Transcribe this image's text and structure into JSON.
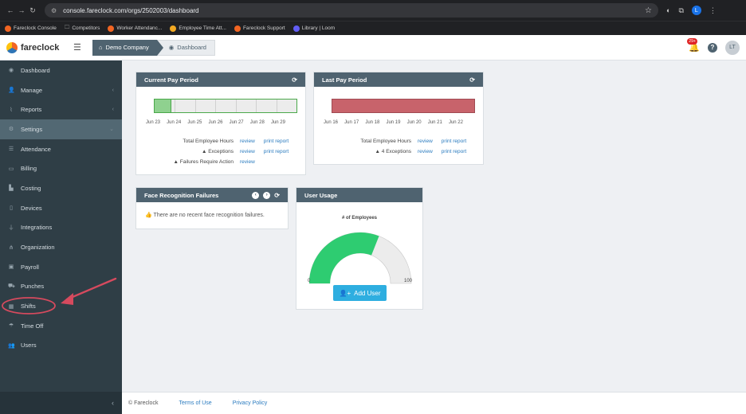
{
  "browser": {
    "url": "console.fareclock.com/orgs/2502003/dashboard",
    "profile_initial": "L",
    "bookmarks": [
      "Fareclock Console",
      "Competitors",
      "Worker Attendanc...",
      "Employee Time Att...",
      "Fareclock Support",
      "Library | Loom"
    ]
  },
  "header": {
    "logo_text": "fareclock",
    "company": "Demo Company",
    "page": "Dashboard",
    "notification_count": "29+",
    "help": "?",
    "avatar_initials": "LT"
  },
  "sidebar": {
    "items": [
      {
        "label": "Dashboard",
        "icon": "dashboard-icon",
        "glyph": "◉"
      },
      {
        "label": "Manage",
        "icon": "user-icon",
        "glyph": "👤",
        "caret": "‹"
      },
      {
        "label": "Reports",
        "icon": "chart-icon",
        "glyph": "⌇",
        "caret": "‹"
      },
      {
        "label": "Settings",
        "icon": "gear-icon",
        "glyph": "⚙",
        "caret": "⌄"
      },
      {
        "label": "Attendance",
        "icon": "list-icon",
        "glyph": "☰"
      },
      {
        "label": "Billing",
        "icon": "card-icon",
        "glyph": "▭"
      },
      {
        "label": "Costing",
        "icon": "bar-chart-icon",
        "glyph": "▙"
      },
      {
        "label": "Devices",
        "icon": "tablet-icon",
        "glyph": "▯"
      },
      {
        "label": "Integrations",
        "icon": "plug-icon",
        "glyph": "⏚"
      },
      {
        "label": "Organization",
        "icon": "sitemap-icon",
        "glyph": "⋔"
      },
      {
        "label": "Payroll",
        "icon": "money-icon",
        "glyph": "▣"
      },
      {
        "label": "Punches",
        "icon": "truck-icon",
        "glyph": "⛟"
      },
      {
        "label": "Shifts",
        "icon": "calendar-icon",
        "glyph": "▦"
      },
      {
        "label": "Time Off",
        "icon": "beach-icon",
        "glyph": "☂"
      },
      {
        "label": "Users",
        "icon": "users-icon",
        "glyph": "👥"
      }
    ],
    "collapse_glyph": "‹"
  },
  "current_pay_period": {
    "title": "Current Pay Period",
    "days": [
      "Jun 23",
      "Jun 24",
      "Jun 25",
      "Jun 26",
      "Jun 27",
      "Jun 28",
      "Jun 29"
    ],
    "progress": 0.12,
    "stats": [
      {
        "label": "Total Employee Hours",
        "review": "review",
        "print": "print report"
      },
      {
        "label": "Exceptions",
        "review": "review",
        "print": "print report"
      },
      {
        "label": "Failures Require Action",
        "review": "review"
      }
    ]
  },
  "last_pay_period": {
    "title": "Last Pay Period",
    "days": [
      "Jun 16",
      "Jun 17",
      "Jun 18",
      "Jun 19",
      "Jun 20",
      "Jun 21",
      "Jun 22"
    ],
    "stats": [
      {
        "label": "Total Employee Hours",
        "review": "review",
        "print": "print report"
      },
      {
        "label": "4 Exceptions",
        "review": "review",
        "print": "print report"
      }
    ]
  },
  "face_recognition": {
    "title": "Face Recognition Failures",
    "message": "There are no recent face recognition failures."
  },
  "user_usage": {
    "title": "User Usage",
    "gauge_title": "# of Employees",
    "min": "0",
    "max": "100",
    "value_fraction": 0.62,
    "button": "Add User"
  },
  "footer": {
    "copyright": "© Fareclock",
    "terms": "Terms of Use",
    "privacy": "Privacy Policy"
  },
  "colors": {
    "sidebar": "#2f3e46",
    "panel_header": "#4f6370",
    "current_fill": "#8fd18f",
    "last_fill": "#c8636b",
    "gauge_fill": "#2ecc71",
    "button": "#2eaee0",
    "annotation": "#d64a5e"
  }
}
